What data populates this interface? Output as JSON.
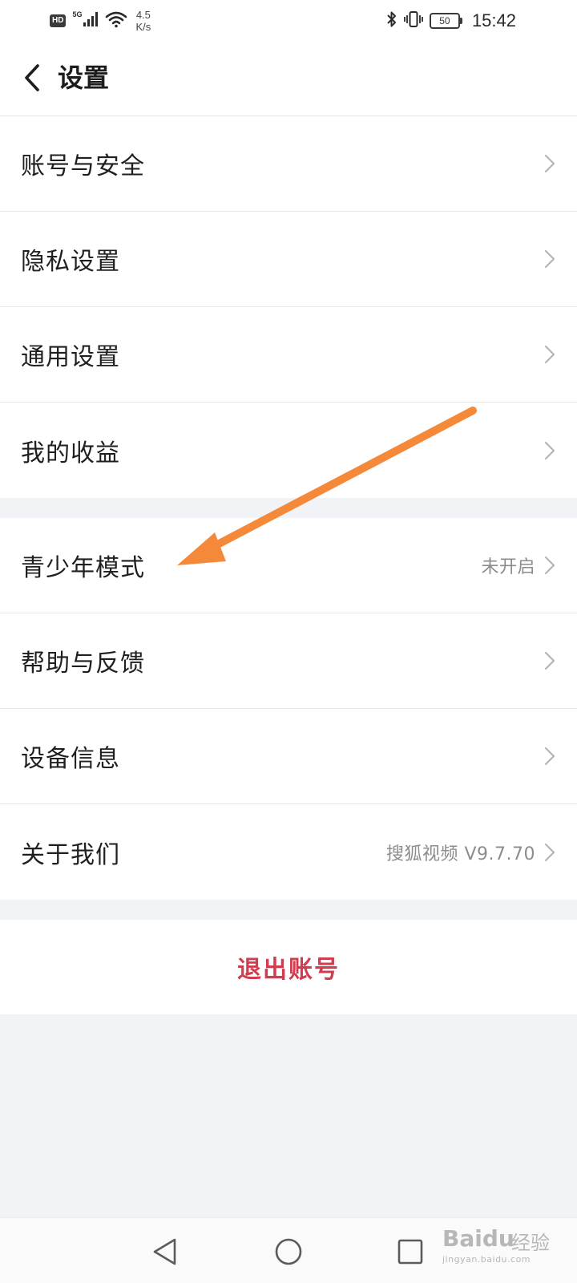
{
  "status_bar": {
    "hd_badge": "HD",
    "network": "5G",
    "speed_value": "4.5",
    "speed_unit": "K/s",
    "battery": "50",
    "time": "15:42"
  },
  "header": {
    "title": "设置"
  },
  "groups": [
    {
      "items": [
        {
          "label": "账号与安全",
          "value": ""
        },
        {
          "label": "隐私设置",
          "value": ""
        },
        {
          "label": "通用设置",
          "value": ""
        },
        {
          "label": "我的收益",
          "value": ""
        }
      ]
    },
    {
      "items": [
        {
          "label": "青少年模式",
          "value": "未开启"
        },
        {
          "label": "帮助与反馈",
          "value": ""
        },
        {
          "label": "设备信息",
          "value": ""
        },
        {
          "label": "关于我们",
          "value": "搜狐视频 V9.7.70"
        }
      ]
    }
  ],
  "logout": {
    "label": "退出账号"
  },
  "watermark": {
    "brand": "Baidu",
    "brand2": "经验",
    "domain": "jingyan.baidu.com"
  },
  "colors": {
    "page_background": "#f1f3f6",
    "logout_text": "#d23c4f",
    "annotation_arrow": "#f5893a",
    "secondary_text": "#8c8c8c"
  }
}
